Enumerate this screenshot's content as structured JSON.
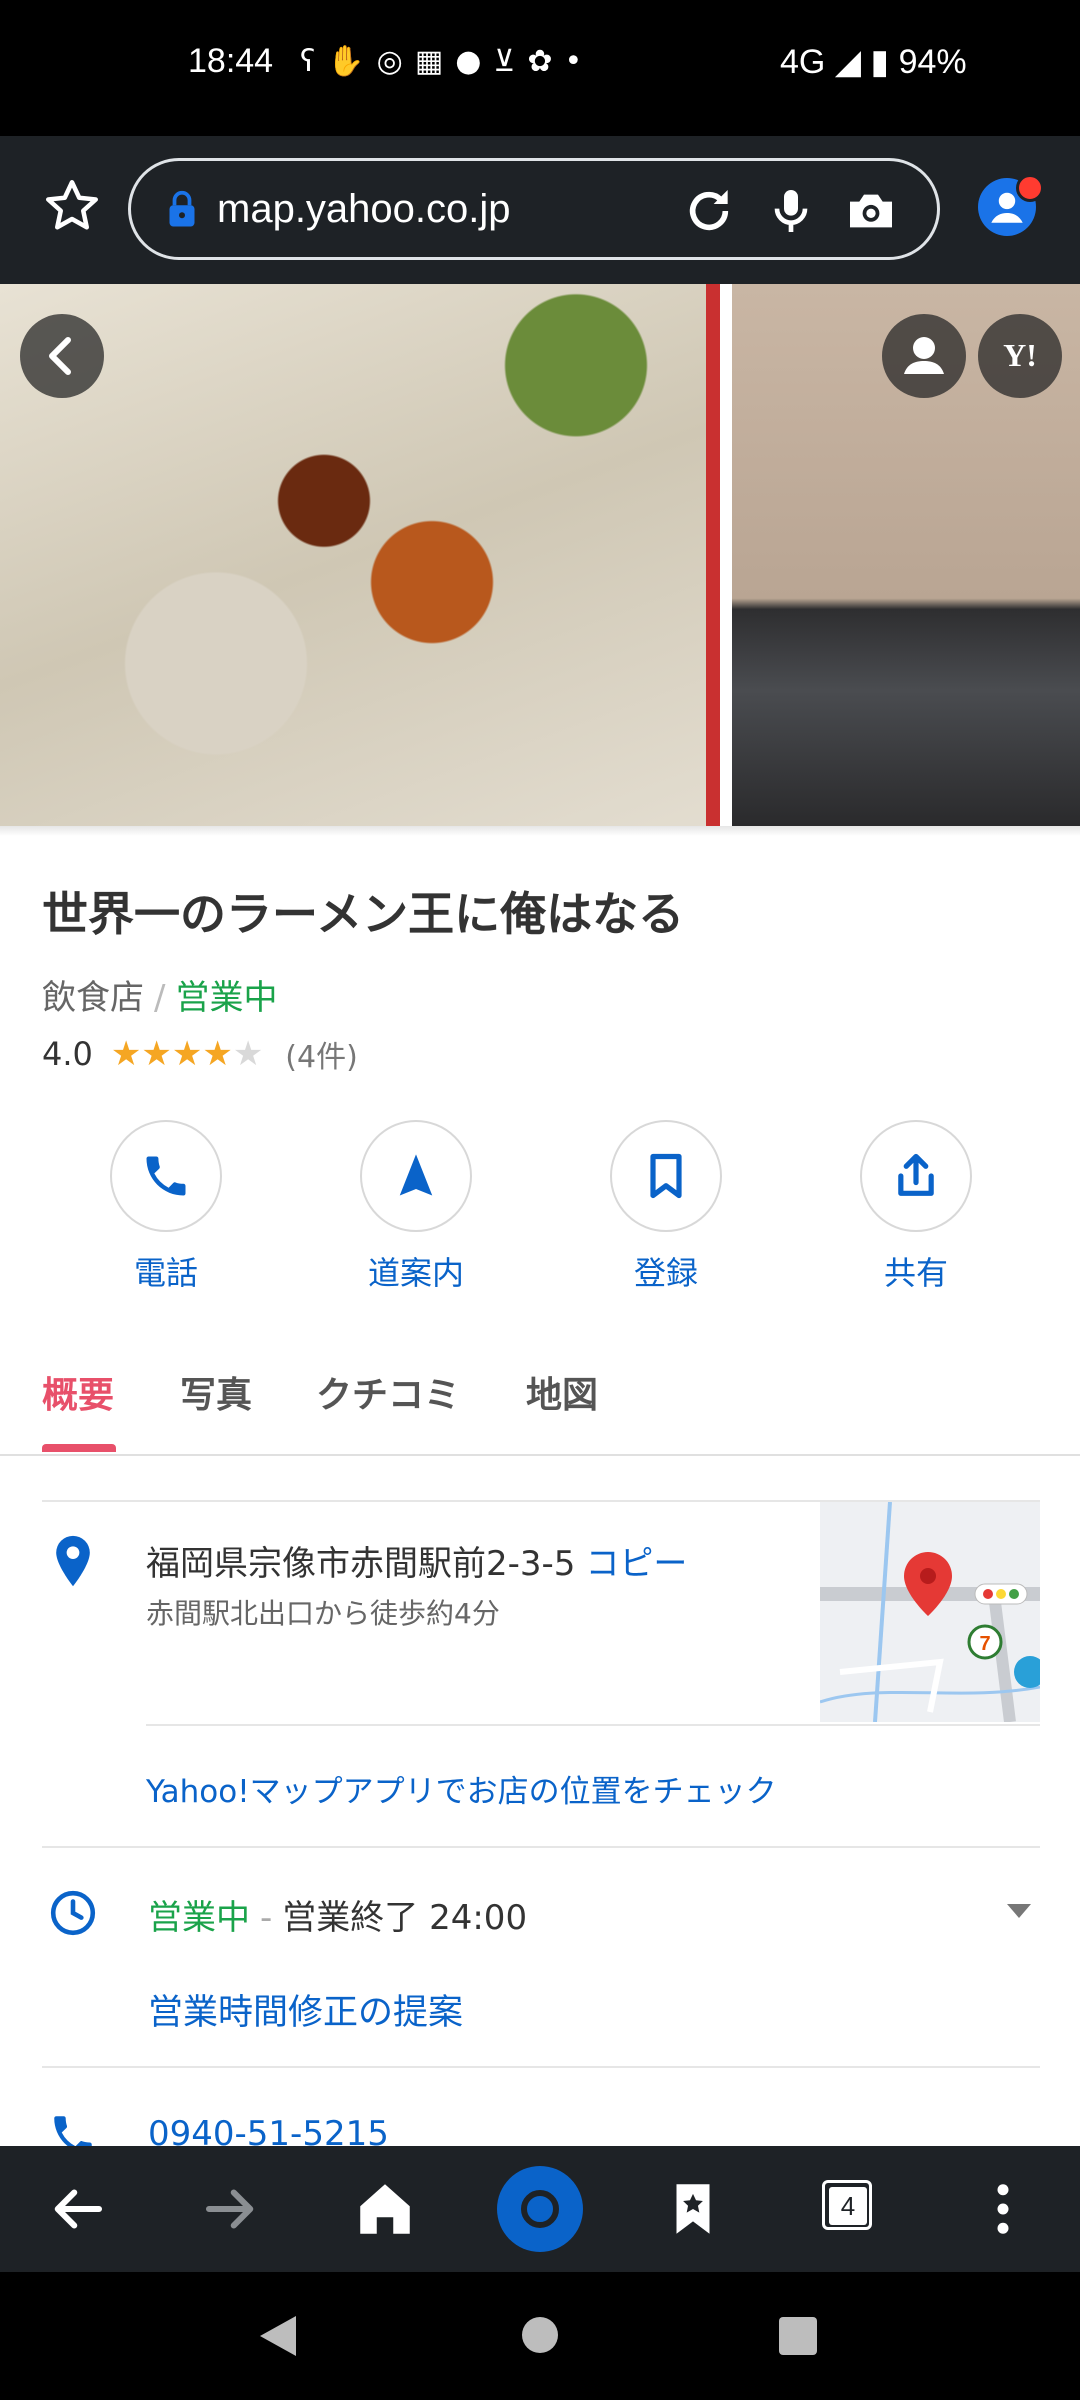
{
  "status_bar": {
    "time": "18:44",
    "notification_icons": [
      "bear-icon",
      "hand-icon",
      "instagram-icon",
      "calendar-icon",
      "gear-icon",
      "cart-icon",
      "flower-icon",
      "dot-icon"
    ],
    "network": "4G",
    "battery": "94%"
  },
  "browser": {
    "url": "map.yahoo.co.jp"
  },
  "place": {
    "name": "世界一のラーメン王に俺はなる",
    "category": "飲食店",
    "separator": "/",
    "status": "営業中",
    "rating_value": "4.0",
    "rating_stars": "★★★★",
    "rating_empty": "★",
    "review_count": "(4件)",
    "rating_fraction": 0.8
  },
  "actions": [
    {
      "label": "電話",
      "icon": "phone-icon"
    },
    {
      "label": "道案内",
      "icon": "navigation-arrow-icon"
    },
    {
      "label": "登録",
      "icon": "bookmark-icon"
    },
    {
      "label": "共有",
      "icon": "share-icon"
    }
  ],
  "tabs": [
    "概要",
    "写真",
    "クチコミ",
    "地図"
  ],
  "active_tab": "概要",
  "info": {
    "address": "福岡県宗像市赤間駅前2-3-5",
    "copy_label": "コピー",
    "access": "赤間駅北出口から徒歩約4分",
    "app_check": "Yahoo!マップアプリでお店の位置をチェック",
    "hours_status": "営業中",
    "hours_sep": "-",
    "hours_text": "営業終了 24:00",
    "hours_suggest": "営業時間修正の提案",
    "phone": "0940-51-5215"
  },
  "bottom_nav": {
    "tab_count": "4"
  },
  "colors": {
    "accent_blue": "#0a63c9",
    "open_green": "#1aa34a",
    "tab_active": "#e8506a",
    "star": "#f5a623"
  }
}
